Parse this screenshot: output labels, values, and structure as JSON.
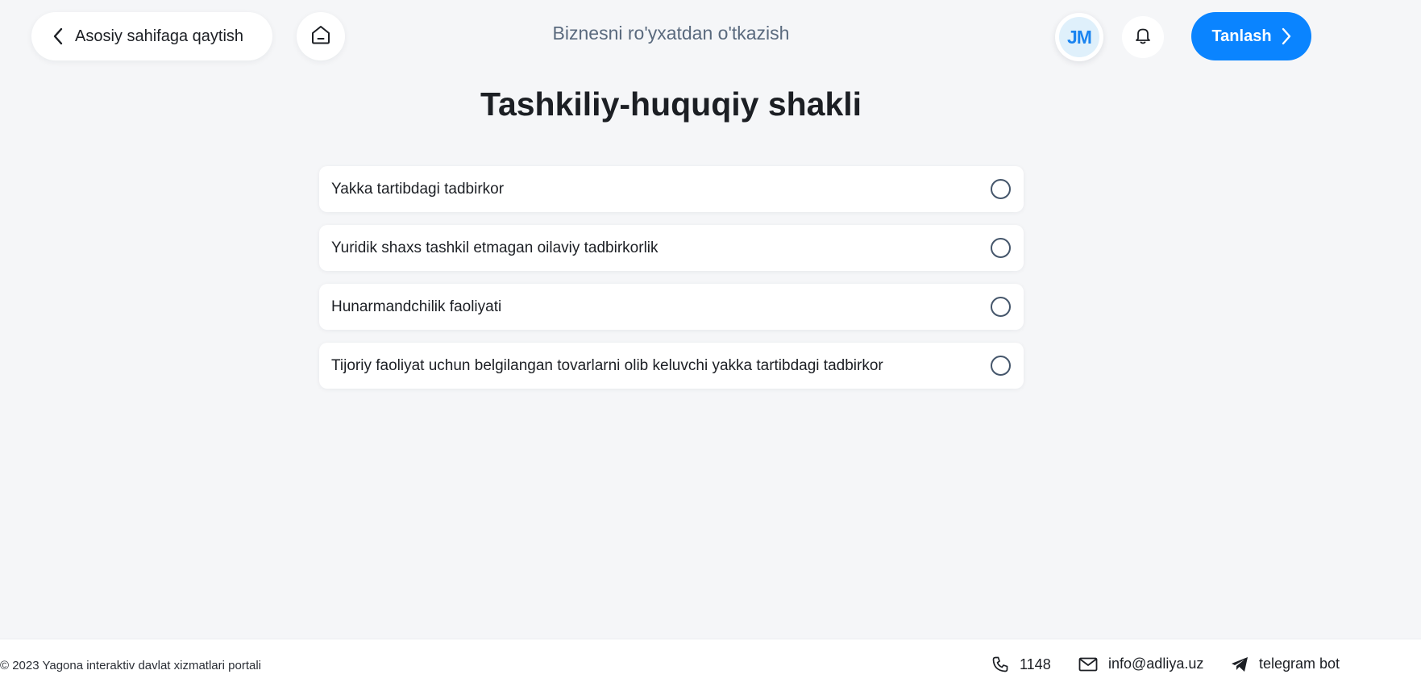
{
  "header": {
    "back_label": "Asosiy sahifaga qaytish",
    "title": "Biznesni ro'yxatdan o'tkazish",
    "avatar_initials": "JM",
    "primary_button_label": "Tanlash"
  },
  "main": {
    "title": "Tashkiliy-huquqiy shakli",
    "options": [
      {
        "label": "Yakka tartibdagi tadbirkor",
        "selected": false
      },
      {
        "label": "Yuridik shaxs tashkil etmagan oilaviy tadbirkorlik",
        "selected": false
      },
      {
        "label": "Hunarmandchilik faoliyati",
        "selected": false
      },
      {
        "label": "Tijoriy faoliyat uchun belgilangan tovarlarni olib keluvchi yakka tartibdagi tadbirkor",
        "selected": false
      }
    ]
  },
  "footer": {
    "copyright": "© 2023 Yagona interaktiv davlat xizmatlari portali",
    "phone": "1148",
    "email": "info@adliya.uz",
    "telegram": "telegram bot"
  },
  "icons": {
    "back": "chevron-left-icon",
    "home": "home-icon",
    "bell": "bell-icon",
    "next": "chevron-right-icon",
    "phone": "phone-icon",
    "email": "mail-icon",
    "telegram": "telegram-icon"
  },
  "colors": {
    "accent": "#0a84ff",
    "background": "#f5f6f8",
    "avatar_bg": "#dff0fb",
    "header_title": "#5a6a7e",
    "radio_border": "#45566b"
  }
}
